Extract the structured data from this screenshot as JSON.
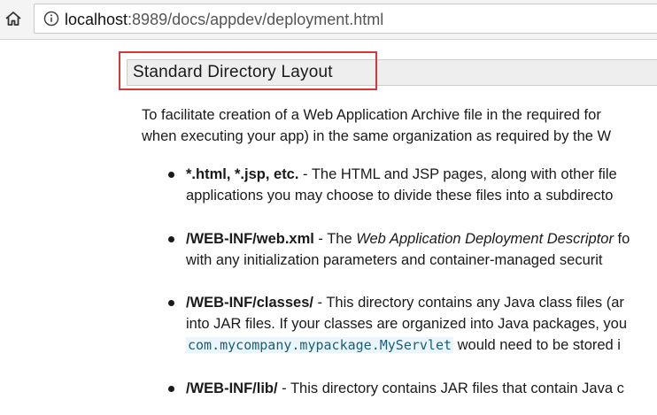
{
  "browser": {
    "url_host": "localhost",
    "url_path": ":8989/docs/appdev/deployment.html",
    "home_icon": "home-icon",
    "info_icon": "info-icon"
  },
  "page": {
    "section_title": "Standard Directory Layout",
    "intro_line1": "To facilitate creation of a Web Application Archive file in the required for",
    "intro_line2": "when executing your app) in the same organization as required by the W",
    "highlight_color": "#d8373a"
  },
  "bullets": [
    {
      "term": "*.html, *.jsp, etc.",
      "line1_rest": " - The HTML and JSP pages, along with other file",
      "line2": "applications you may choose to divide these files into a subdirecto"
    },
    {
      "term": "/WEB-INF/web.xml",
      "line1_pre": " - The ",
      "line1_em": "Web Application Deployment Descriptor",
      "line1_post": " fo",
      "line2": "with any initialization parameters and container-managed securit"
    },
    {
      "term": "/WEB-INF/classes/",
      "line1_rest": " - This directory contains any Java class files (ar",
      "line2": "into JAR files. If your classes are organized into Java packages, you",
      "line3_code": "com.mycompany.mypackage.MyServlet",
      "line3_rest": " would need to be stored i"
    },
    {
      "term": "/WEB-INF/lib/",
      "line1_rest": " - This directory contains JAR files that contain Java c"
    }
  ]
}
